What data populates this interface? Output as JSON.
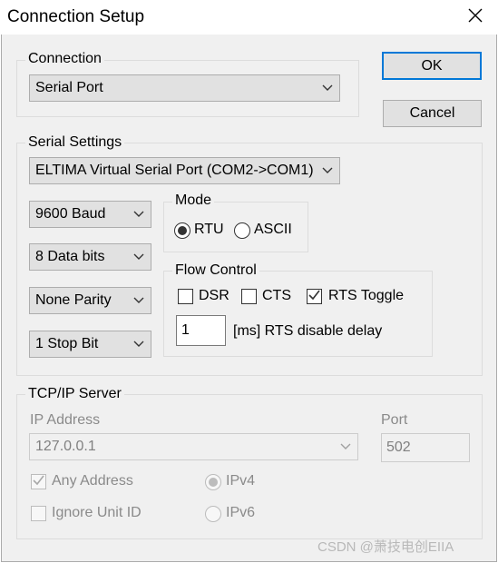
{
  "window": {
    "title": "Connection Setup",
    "close_glyph": "✕"
  },
  "buttons": {
    "ok": "OK",
    "cancel": "Cancel"
  },
  "connection": {
    "group_label": "Connection",
    "selected": "Serial Port"
  },
  "serial": {
    "group_label": "Serial Settings",
    "port": "ELTIMA Virtual Serial Port (COM2->COM1)",
    "baud": "9600 Baud",
    "data_bits": "8 Data bits",
    "parity": "None Parity",
    "stop_bits": "1 Stop Bit",
    "mode": {
      "label": "Mode",
      "rtu": "RTU",
      "ascii": "ASCII",
      "selected": "RTU"
    },
    "flow": {
      "label": "Flow Control",
      "dsr": "DSR",
      "dsr_checked": false,
      "cts": "CTS",
      "cts_checked": false,
      "rts_toggle": "RTS Toggle",
      "rts_toggle_checked": true,
      "delay_value": "1",
      "delay_label": "[ms] RTS disable delay"
    }
  },
  "tcp": {
    "group_label": "TCP/IP Server",
    "ip_label": "IP Address",
    "ip_value": "127.0.0.1",
    "port_label": "Port",
    "port_value": "502",
    "any_address": "Any Address",
    "any_address_checked": true,
    "ignore_unit_id": "Ignore Unit ID",
    "ignore_unit_id_checked": false,
    "ipv4": "IPv4",
    "ipv6": "IPv6",
    "ip_selected": "IPv4"
  },
  "watermark": "CSDN @萧技电创EIIA"
}
